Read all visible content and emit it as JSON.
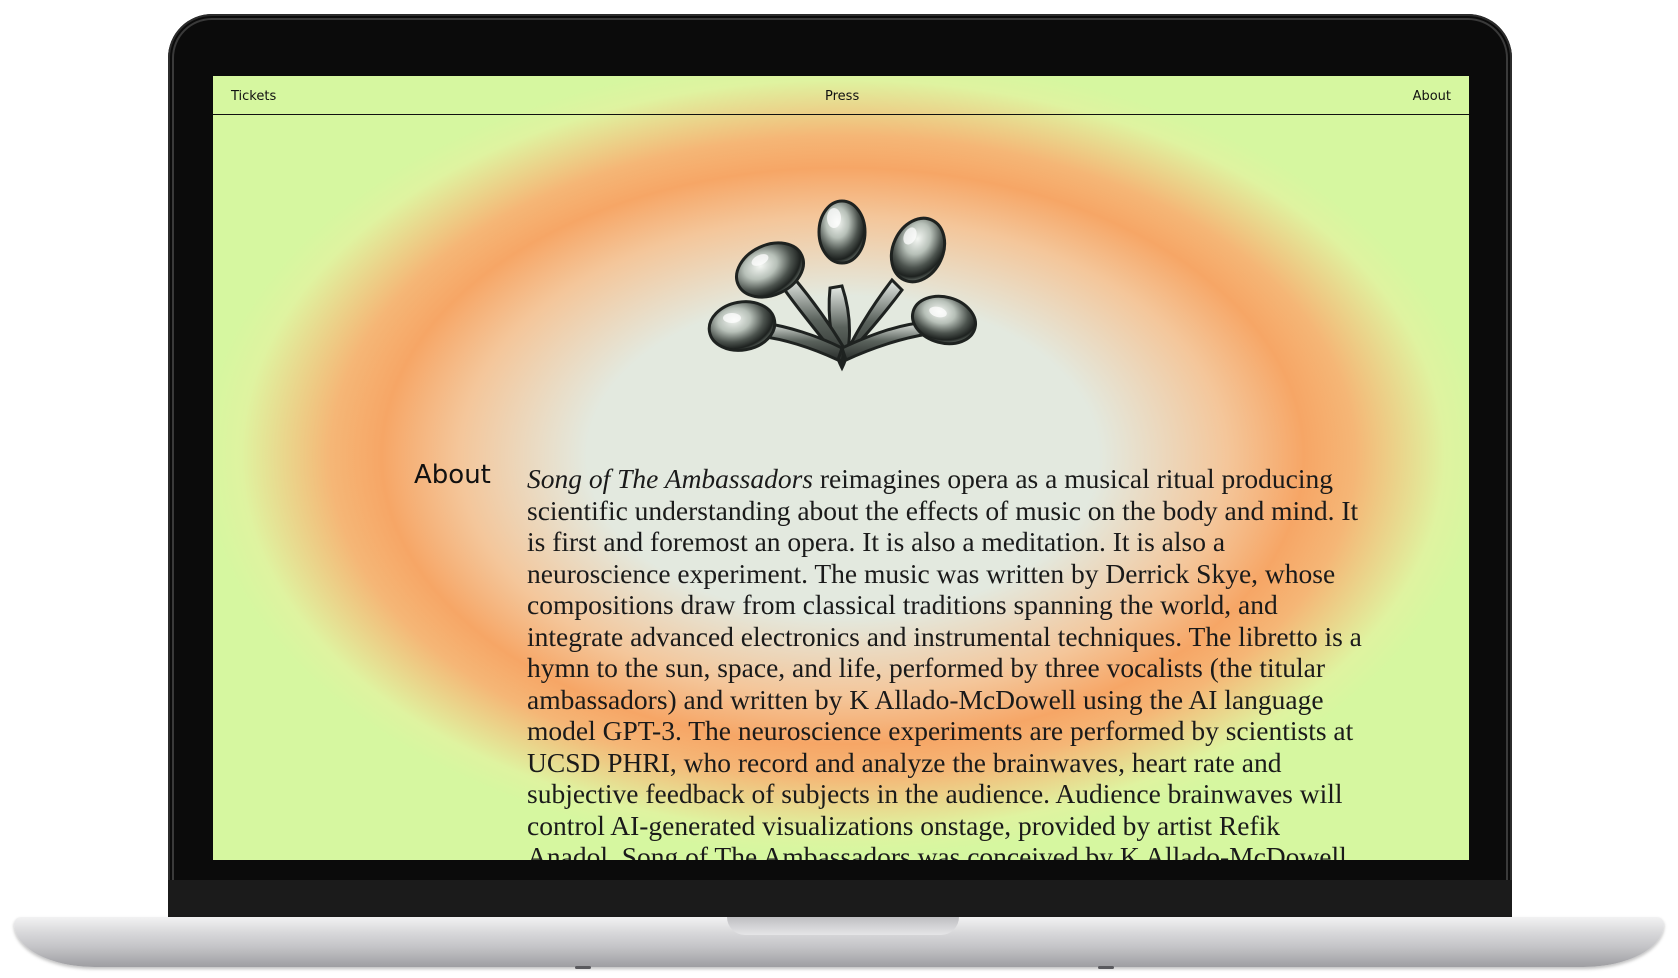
{
  "nav": {
    "tickets": "Tickets",
    "press": "Press",
    "about": "About"
  },
  "logo": {
    "icon": "chrome-splash-icon"
  },
  "about": {
    "heading": "About",
    "title_italic": "Song of The Ambassadors",
    "body": " reimagines opera as a musical ritual producing scientific understanding about the effects of music on the body and mind. It is first and foremost an opera. It is also a meditation. It is also a neuroscience experiment. The music was written by Derrick Skye, whose compositions draw from classical traditions spanning the world, and integrate advanced electronics and instrumental techniques. The libretto is a hymn to the sun, space, and life, performed by three vocalists (the titular ambassadors) and written by K Allado-McDowell using the AI language model GPT-3. The neuroscience experiments are performed by scientists at UCSD PHRI, who record and analyze the brainwaves, heart rate and subjective feedback of subjects in the audience. Audience brainwaves will control AI-generated visualizations onstage, provided by artist Refik Anadol. Song of The Ambassadors was conceived by K Allado-McDowell"
  },
  "colors": {
    "background_center": "#e3e9df",
    "background_ring": "#f6a666",
    "background_edge": "#d6f7a0",
    "text": "#1a1a1a"
  }
}
